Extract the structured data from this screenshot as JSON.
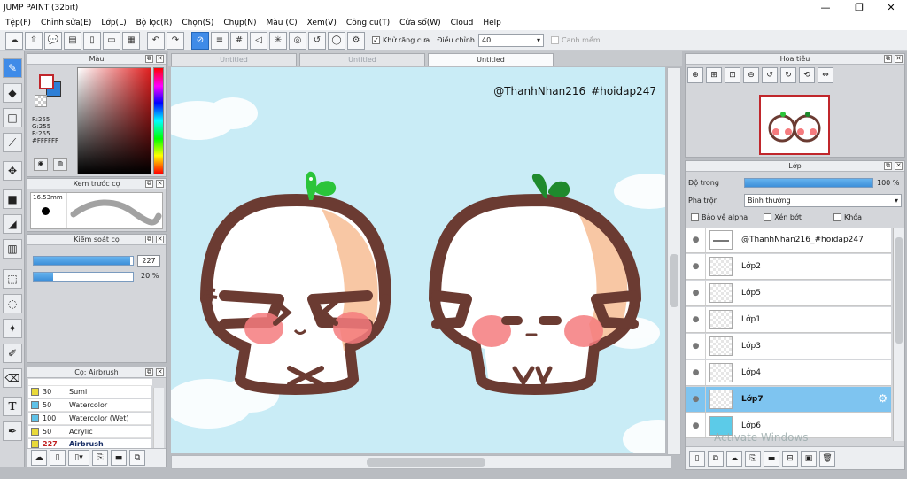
{
  "window": {
    "title": "JUMP PAINT (32bit)",
    "minimize": "—",
    "maximize": "❐",
    "close": "✕"
  },
  "menu": [
    "Tệp(F)",
    "Chỉnh sửa(E)",
    "Lớp(L)",
    "Bộ lọc(R)",
    "Chọn(S)",
    "Chụp(N)",
    "Màu (C)",
    "Xem(V)",
    "Công cụ(T)",
    "Cửa sổ(W)",
    "Cloud",
    "Help"
  ],
  "toolbar": {
    "antialias_label": "Khử răng cưa",
    "correction_label": "Điều chỉnh",
    "correction_value": "40",
    "snap_label": "Canh mềm"
  },
  "color_panel": {
    "title": "Màu",
    "r": "R:255",
    "g": "G:255",
    "b": "B:255",
    "hex": "#FFFFFF",
    "fg_color": "#ffffff",
    "bg_color": "#2e7fd6"
  },
  "brush_preview": {
    "title": "Xem trước cọ",
    "size": "16.53mm"
  },
  "brush_control": {
    "title": "Kiểm soát cọ",
    "size_value": "227",
    "opacity_value": "20 %",
    "size_fraction": 0.97,
    "opacity_fraction": 0.2
  },
  "brush_list": {
    "title": "Cọ: Airbrush",
    "items": [
      {
        "size": "30",
        "name": "Sumi",
        "color": "#e8d93a"
      },
      {
        "size": "50",
        "name": "Watercolor",
        "color": "#5fc2e8"
      },
      {
        "size": "100",
        "name": "Watercolor (Wet)",
        "color": "#5fc2e8"
      },
      {
        "size": "50",
        "name": "Acrylic",
        "color": "#e8d93a"
      },
      {
        "size": "227",
        "name": "Airbrush",
        "color": "#e8d93a"
      }
    ]
  },
  "tabs": [
    "Untitled",
    "Untitled",
    "Untitled"
  ],
  "canvas": {
    "watermark": "@ThanhNhan216_#hoidap247"
  },
  "navigator": {
    "title": "Hoa tiêu"
  },
  "layers": {
    "title": "Lớp",
    "opacity_label": "Độ trong",
    "opacity_value": "100 %",
    "opacity_fraction": 1.0,
    "blend_label": "Pha trộn",
    "blend_value": "Bình thường",
    "protect_alpha": "Bảo vệ alpha",
    "clipping": "Xén bớt",
    "lock": "Khóa",
    "items": [
      {
        "name": "@ThanhNhan216_#hoidap247"
      },
      {
        "name": "Lớp2"
      },
      {
        "name": "Lớp5"
      },
      {
        "name": "Lớp1"
      },
      {
        "name": "Lớp3"
      },
      {
        "name": "Lớp4"
      },
      {
        "name": "Lớp7"
      },
      {
        "name": "Lớp6"
      }
    ]
  },
  "os_overlay": "Activate Windows"
}
